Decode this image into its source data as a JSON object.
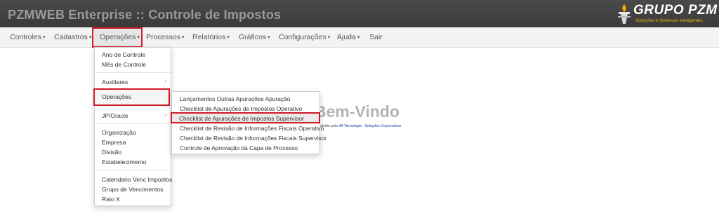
{
  "app": {
    "title": "PZMWEB Enterprise :: Controle de Impostos",
    "logo_text": "GRUPO PZM",
    "logo_tagline": "Soluções e Sistemas Inteligentes"
  },
  "nav": {
    "items": [
      {
        "label": "Controles",
        "caret": "▾"
      },
      {
        "label": "Cadastros",
        "caret": "▾"
      },
      {
        "label": "Operações",
        "caret": "▾"
      },
      {
        "label": "Processos",
        "caret": "▾"
      },
      {
        "label": "Relatórios",
        "caret": "▾"
      },
      {
        "label": "Gráficos",
        "caret": "▾"
      },
      {
        "label": "Configurações",
        "caret": "▾"
      },
      {
        "label": "Ajuda",
        "caret": "▾"
      },
      {
        "label": "Sair"
      }
    ],
    "active": "Operações"
  },
  "dropdown": {
    "items": [
      {
        "label": "Ano de Controle"
      },
      {
        "label": "Mês de Controle"
      },
      {
        "label": "Auxiliares",
        "arrow": "›"
      },
      {
        "label": "Operações"
      },
      {
        "label": "JP/Oracle",
        "arrow": "›"
      },
      {
        "label": "Organização"
      },
      {
        "label": "Empresa"
      },
      {
        "label": "Divisão"
      },
      {
        "label": "Estabelecimento"
      },
      {
        "label": "Calendario Venc Impostos"
      },
      {
        "label": "Grupo de Vencimentos"
      },
      {
        "label": "Raio X"
      }
    ]
  },
  "submenu": {
    "items": [
      {
        "label": "Lançamentos Outras Apurações Apuração"
      },
      {
        "label": "Checklist de Apurações de Impostos Operativo"
      },
      {
        "label": "Checklist de Apurações de Impostos Supervisor"
      },
      {
        "label": "Checklist de Revisão de Informações Fiscais Operativo"
      },
      {
        "label": "Checklist de Revisão de Informações Fiscais Supervisor"
      },
      {
        "label": "Controle de Aprovação da Capa de Processo"
      }
    ]
  },
  "welcome": {
    "title": "Bem-Vindo",
    "dev_prefix": "olvido pela",
    "dev_brand": "4A Tecnologia - Soluções Corporativas"
  },
  "colors": {
    "topbar": "#3f3f3f",
    "highlight_border": "#d11a2a",
    "logo_accent": "#f0b400"
  }
}
